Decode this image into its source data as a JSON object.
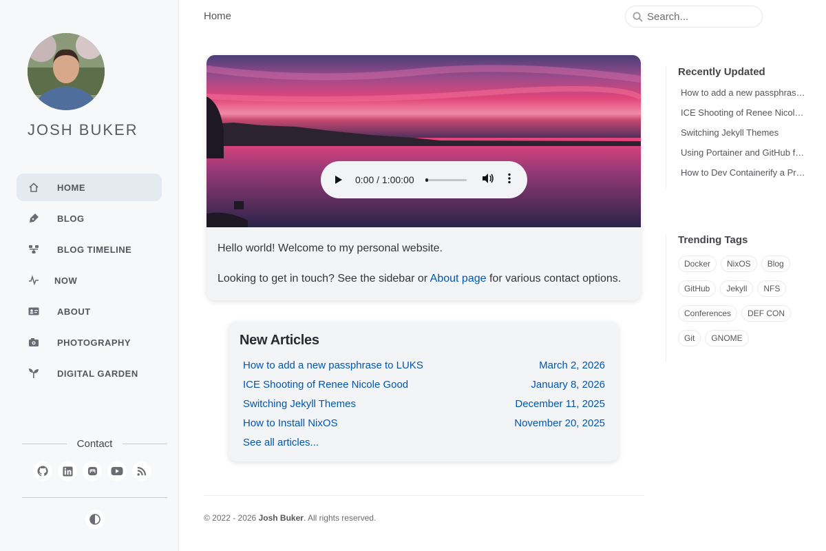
{
  "sidebar": {
    "title": "JOSH BUKER",
    "nav": [
      {
        "label": "HOME",
        "icon": "home-icon",
        "active": true
      },
      {
        "label": "BLOG",
        "icon": "pen-icon"
      },
      {
        "label": "BLOG TIMELINE",
        "icon": "timeline-icon"
      },
      {
        "label": "NOW",
        "icon": "pulse-icon"
      },
      {
        "label": "ABOUT",
        "icon": "id-card-icon"
      },
      {
        "label": "PHOTOGRAPHY",
        "icon": "camera-icon"
      },
      {
        "label": "DIGITAL GARDEN",
        "icon": "seedling-icon"
      }
    ],
    "contact_label": "Contact",
    "social": [
      "github-icon",
      "linkedin-icon",
      "mastodon-icon",
      "youtube-icon",
      "rss-icon"
    ],
    "mode_toggle_icon": "contrast-icon"
  },
  "topbar": {
    "breadcrumb": "Home",
    "search_placeholder": "Search..."
  },
  "hero": {
    "audio": {
      "time": "0:00 / 1:00:00",
      "progress": 0
    },
    "text1": "Hello world! Welcome to my personal website.",
    "text2_before": "Looking to get in touch? See the sidebar or ",
    "text2_link": "About page",
    "text2_after": " for various contact options."
  },
  "new_articles": {
    "title": "New Articles",
    "items": [
      {
        "title": "How to add a new passphrase to LUKS",
        "date": "March 2, 2026"
      },
      {
        "title": "ICE Shooting of Renee Nicole Good",
        "date": "January 8, 2026"
      },
      {
        "title": "Switching Jekyll Themes",
        "date": "December 11, 2025"
      },
      {
        "title": "How to Install NixOS",
        "date": "November 20, 2025"
      }
    ],
    "see_all": "See all articles..."
  },
  "footer": {
    "prefix": "© 2022 - 2026 ",
    "author": "Josh Buker",
    "suffix": ". All rights reserved."
  },
  "recently_updated": {
    "title": "Recently Updated",
    "items": [
      "How to add a new passphrase to LUKS",
      "ICE Shooting of Renee Nicole Good",
      "Switching Jekyll Themes",
      "Using Portainer and GitHub for GitOps",
      "How to Dev Containerify a Project"
    ]
  },
  "trending_tags": {
    "title": "Trending Tags",
    "tags": [
      "Docker",
      "NixOS",
      "Blog",
      "GitHub",
      "Jekyll",
      "NFS",
      "Conferences",
      "DEF CON",
      "Git",
      "GNOME"
    ]
  }
}
